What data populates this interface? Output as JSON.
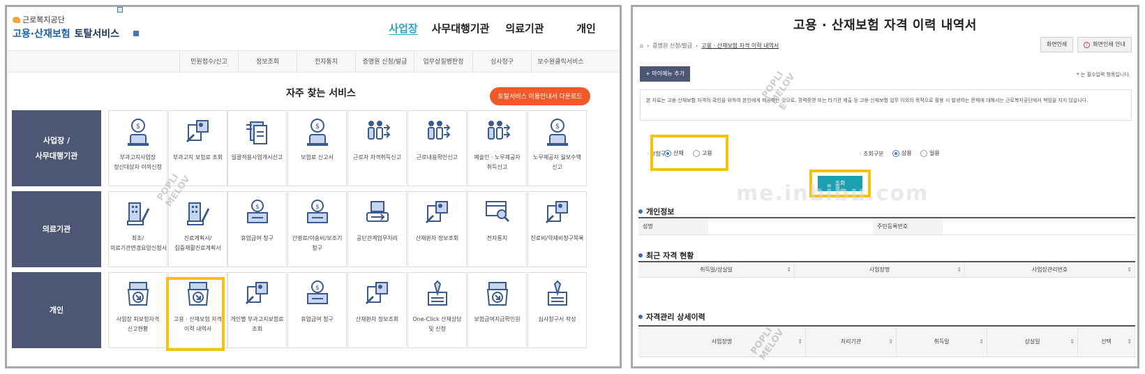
{
  "left": {
    "logo_small": "근로복지공단",
    "logo_main_a": "고용·산재보험",
    "logo_main_b": "토탈서비스",
    "main_nav": [
      "사업장",
      "사무대행기관",
      "의료기관",
      "개인"
    ],
    "active_nav": "사업장",
    "sub_nav": [
      "민원접수/신고",
      "정보조회",
      "전자통지",
      "증명원 신청/발급",
      "업무상질병판정",
      "심사청구",
      "보수원클릭서비스"
    ],
    "section_title": "자주 찾는 서비스",
    "guide_button": "토탈서비스 이용안내서 다운로드",
    "rows": [
      {
        "category": [
          "사업장 /",
          "사무대행기관"
        ],
        "cards": [
          {
            "icon": "coin-person-icon",
            "label": "부과고지사업장 정산대상자 이의신청"
          },
          {
            "icon": "document-search-icon",
            "label": "부과고지 보험료 조회"
          },
          {
            "icon": "document-stack-icon",
            "label": "일괄적용사업개시신고"
          },
          {
            "icon": "coin-person-icon",
            "label": "보험료 신고서"
          },
          {
            "icon": "people-flow-icon",
            "label": "근로자 자격취득신고"
          },
          {
            "icon": "people-flow-icon",
            "label": "근로내용확인신고"
          },
          {
            "icon": "people-flow-icon",
            "label": "예술인 · 노무제공자 취득신고"
          },
          {
            "icon": "coin-person-icon",
            "label": "노무제공자 월보수액 신고"
          }
        ]
      },
      {
        "category": [
          "의료기관"
        ],
        "cards": [
          {
            "icon": "building-pen-icon",
            "label": "최초/의료기관변경요양신청서"
          },
          {
            "icon": "building-pen-icon",
            "label": "진료계획서/집중재활진료계획서"
          },
          {
            "icon": "money-box-icon",
            "label": "휴업급여 청구"
          },
          {
            "icon": "money-box-icon",
            "label": "간병료/이송비/보조기 청구"
          },
          {
            "icon": "hospital-exchange-icon",
            "label": "공단관계업무처리"
          },
          {
            "icon": "document-search-icon",
            "label": "산재환자 정보조회"
          },
          {
            "icon": "monitor-search-icon",
            "label": "전자통지"
          },
          {
            "icon": "document-search-icon",
            "label": "진료비/약제비청구목록"
          }
        ]
      },
      {
        "category": [
          "개인"
        ],
        "cards": [
          {
            "icon": "tray-arrow-icon",
            "label": "사업장 피보험자격 신고현황"
          },
          {
            "icon": "tray-arrow-icon",
            "label": "고용 · 산재보험 자격 이력 내역서"
          },
          {
            "icon": "document-search-icon",
            "label": "개인별 부과고지보험료 조회"
          },
          {
            "icon": "money-box-icon",
            "label": "휴업급여 청구"
          },
          {
            "icon": "document-search-icon",
            "label": "산재환자 정보조회"
          },
          {
            "icon": "pen-document-icon",
            "label": "One-Click 산재상담 및 신청"
          },
          {
            "icon": "tray-arrow-icon",
            "label": "보험급여지급확인원"
          },
          {
            "icon": "pen-document-icon",
            "label": "심사청구서 작성"
          }
        ]
      }
    ]
  },
  "right": {
    "title": "고용 · 산재보험 자격 이력 내역서",
    "breadcrumb": [
      "증명원 신청/발급",
      "고용 · 산재보험 자격 이력 내역서"
    ],
    "print_button": "화면인쇄",
    "print_guide_button": "화면인쇄 안내",
    "my_menu_button": "+ 마이메뉴 추가",
    "required_note": "는 필수입력 항목입니다.",
    "notice": "본 자료는 고용·산재보험 자격의 확인을 위하여 본인에게 제공하는 것으로, 경력증명 또는 타기관 제출 등 고용·산재보험 업무 이외의 목적으로 활용 시 발생하는 문제에 대해서는 근로복지공단에서 책임을 지지 않습니다.",
    "insurance_label": "· 보험구분",
    "insurance_options": [
      "산재",
      "고용"
    ],
    "insurance_selected": "산재",
    "query_label": "· 조회구분",
    "query_options": [
      "상용",
      "일용"
    ],
    "query_selected": "상용",
    "search_button": "조회",
    "site_watermark": "me.inbibu.com",
    "personal_section": "개인정보",
    "personal_fields": [
      "성명",
      "주민등록번호"
    ],
    "recent_section": "최근 자격 현황",
    "recent_columns": [
      "취득일/상실일",
      "사업장명",
      "사업장관리번호"
    ],
    "detail_section": "자격관리 상세이력",
    "detail_columns": [
      "사업장명",
      "처리기관",
      "취득일",
      "상실일",
      "선택"
    ]
  },
  "watermarks": [
    "POPLI\nMELOV",
    "POPLI\nMELOV\nE",
    "POPLI\nMELOV"
  ]
}
